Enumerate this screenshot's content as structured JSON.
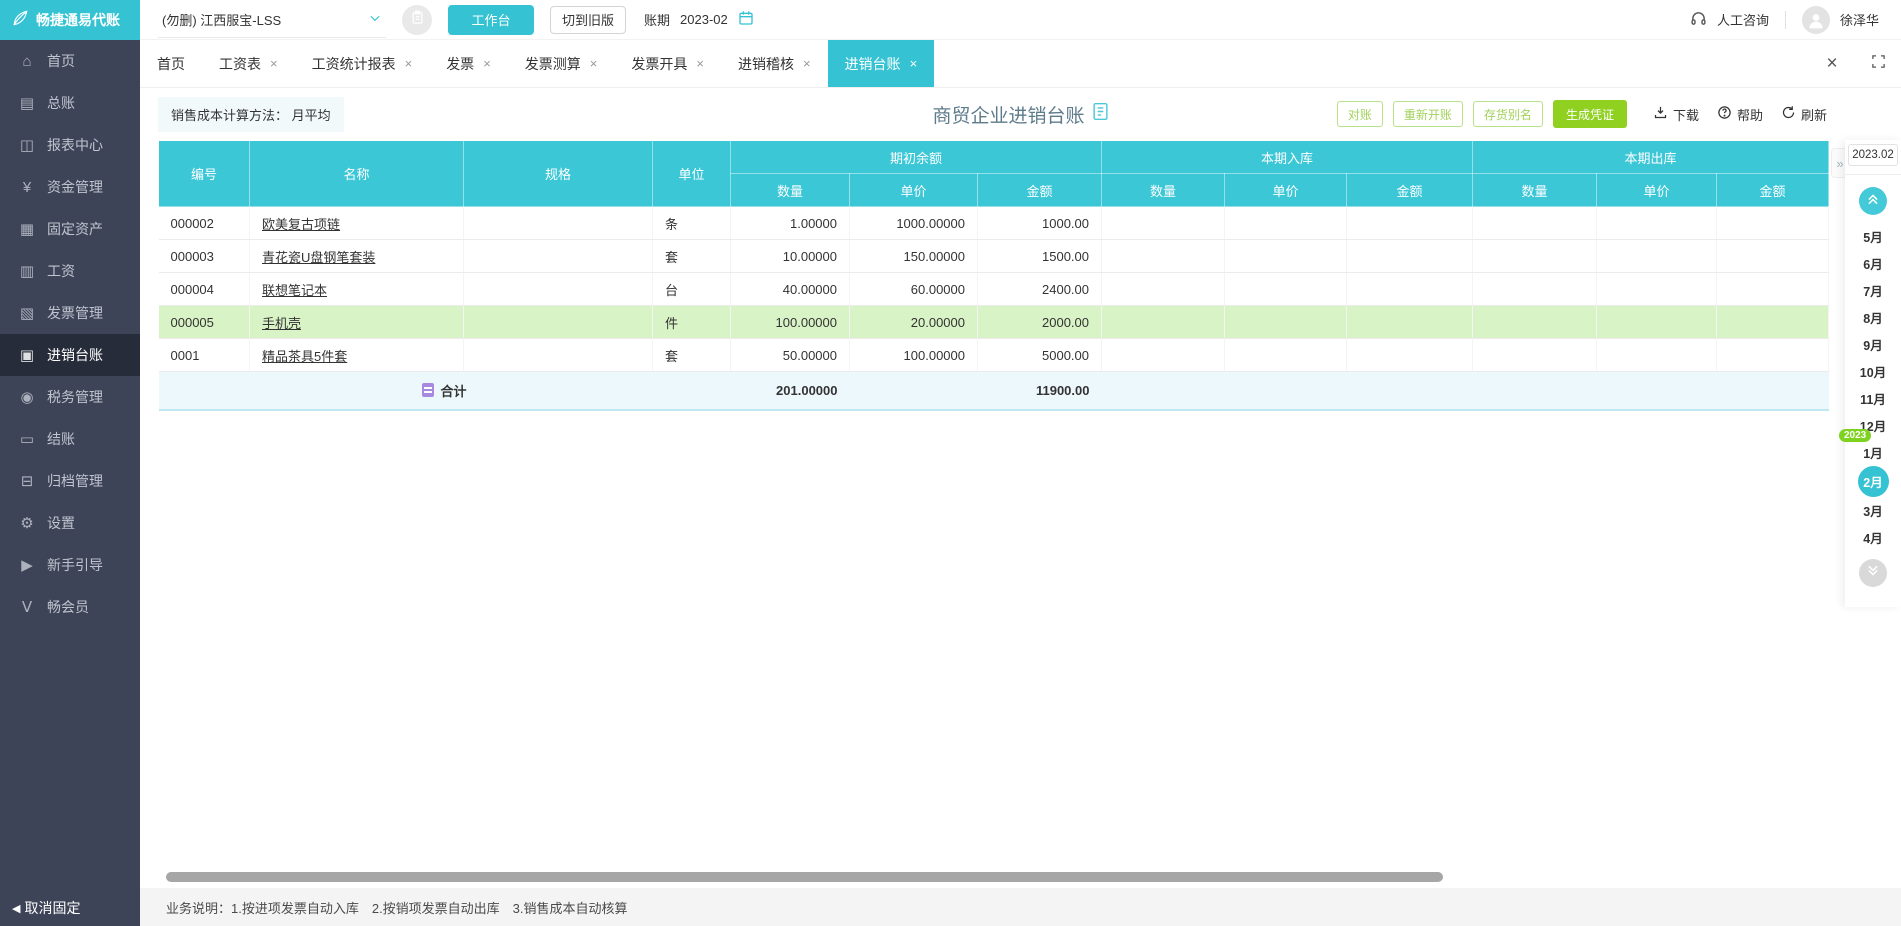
{
  "topbar": {
    "logo": "畅捷通易代账",
    "company": "(勿删) 江西服宝-LSS",
    "workbench": "工作台",
    "switch_old": "切到旧版",
    "period_label": "账期",
    "period_value": "2023-02",
    "consult": "人工咨询",
    "username": "徐泽华"
  },
  "sidebar": {
    "items": [
      {
        "name": "home",
        "label": "首页",
        "icon": "⌂",
        "active": false
      },
      {
        "name": "general-ledger",
        "label": "总账",
        "icon": "▤",
        "active": false
      },
      {
        "name": "report-center",
        "label": "报表中心",
        "icon": "◫",
        "active": false
      },
      {
        "name": "funds-management",
        "label": "资金管理",
        "icon": "¥",
        "active": false
      },
      {
        "name": "fixed-assets",
        "label": "固定资产",
        "icon": "▦",
        "active": false
      },
      {
        "name": "payroll",
        "label": "工资",
        "icon": "▥",
        "active": false
      },
      {
        "name": "invoice-management",
        "label": "发票管理",
        "icon": "▧",
        "active": false
      },
      {
        "name": "purchase-sale-ledger",
        "label": "进销台账",
        "icon": "▣",
        "active": true
      },
      {
        "name": "tax-management",
        "label": "税务管理",
        "icon": "◉",
        "active": false
      },
      {
        "name": "closing",
        "label": "结账",
        "icon": "▭",
        "active": false
      },
      {
        "name": "archive-management",
        "label": "归档管理",
        "icon": "⊟",
        "active": false
      },
      {
        "name": "settings",
        "label": "设置",
        "icon": "⚙",
        "active": false
      },
      {
        "name": "beginner-guide",
        "label": "新手引导",
        "icon": "▶",
        "active": false
      },
      {
        "name": "member",
        "label": "畅会员",
        "icon": "Ⅴ",
        "active": false
      }
    ],
    "unpin_icon": "◀",
    "unpin": "取消固定"
  },
  "tabs": {
    "close_icon": "×",
    "items": [
      {
        "name": "home",
        "label": "首页",
        "closable": false,
        "active": false
      },
      {
        "name": "payroll-sheet",
        "label": "工资表",
        "closable": true,
        "active": false
      },
      {
        "name": "payroll-stats-report",
        "label": "工资统计报表",
        "closable": true,
        "active": false
      },
      {
        "name": "invoice",
        "label": "发票",
        "closable": true,
        "active": false
      },
      {
        "name": "invoice-calc",
        "label": "发票测算",
        "closable": true,
        "active": false
      },
      {
        "name": "invoice-issue",
        "label": "发票开具",
        "closable": true,
        "active": false
      },
      {
        "name": "purchase-sale-audit",
        "label": "进销稽核",
        "closable": true,
        "active": false
      },
      {
        "name": "purchase-sale-ledger",
        "label": "进销台账",
        "closable": true,
        "active": true
      }
    ]
  },
  "toolbar": {
    "cost_method_label": "销售成本计算方法：",
    "cost_method_value": "月平均",
    "title": "商贸企业进销台账",
    "btn_reconcile": "对账",
    "btn_reopen": "重新开账",
    "btn_alias": "存货别名",
    "btn_voucher": "生成凭证",
    "link_download": "下载",
    "link_help": "帮助",
    "link_refresh": "刷新"
  },
  "table": {
    "col_no": "编号",
    "col_name": "名称",
    "col_spec": "规格",
    "col_unit": "单位",
    "group_opening": "期初余额",
    "group_in": "本期入库",
    "group_out": "本期出库",
    "sub_qty": "数量",
    "sub_price": "单价",
    "sub_amount": "金额",
    "rows": [
      {
        "no": "000002",
        "name": "欧美复古项链",
        "spec": "",
        "unit": "条",
        "qty": "1.00000",
        "price": "1000.00000",
        "amount": "1000.00",
        "highlight": false
      },
      {
        "no": "000003",
        "name": "青花瓷U盘钢笔套装",
        "spec": "",
        "unit": "套",
        "qty": "10.00000",
        "price": "150.00000",
        "amount": "1500.00",
        "highlight": false
      },
      {
        "no": "000004",
        "name": "联想笔记本",
        "spec": "",
        "unit": "台",
        "qty": "40.00000",
        "price": "60.00000",
        "amount": "2400.00",
        "highlight": false
      },
      {
        "no": "000005",
        "name": "手机壳",
        "spec": "",
        "unit": "件",
        "qty": "100.00000",
        "price": "20.00000",
        "amount": "2000.00",
        "highlight": true
      },
      {
        "no": "0001",
        "name": "精品茶具5件套",
        "spec": "",
        "unit": "套",
        "qty": "50.00000",
        "price": "100.00000",
        "amount": "5000.00",
        "highlight": false
      }
    ],
    "total_label": "合计",
    "total_qty": "201.00000",
    "total_amount": "11900.00"
  },
  "month_panel": {
    "period": "2023.02",
    "year_badge": "2023",
    "badge_before": "1月",
    "active_month": "2月",
    "months": [
      "5月",
      "6月",
      "7月",
      "8月",
      "9月",
      "10月",
      "11月",
      "12月",
      "1月",
      "2月",
      "3月",
      "4月"
    ],
    "expand_icon": "»"
  },
  "statusbar": {
    "note": "业务说明：1.按进项发票自动入库　2.按销项发票自动出库　3.销售成本自动核算"
  },
  "colors": {
    "teal": "#35c3d3",
    "header_teal": "#3cc7d7",
    "sidebar_bg": "#3e4457",
    "green_primary": "#8fd021",
    "row_highlight": "#d8f3c5",
    "totals_bg": "#edf8fd",
    "year_badge_green": "#7ed321"
  }
}
